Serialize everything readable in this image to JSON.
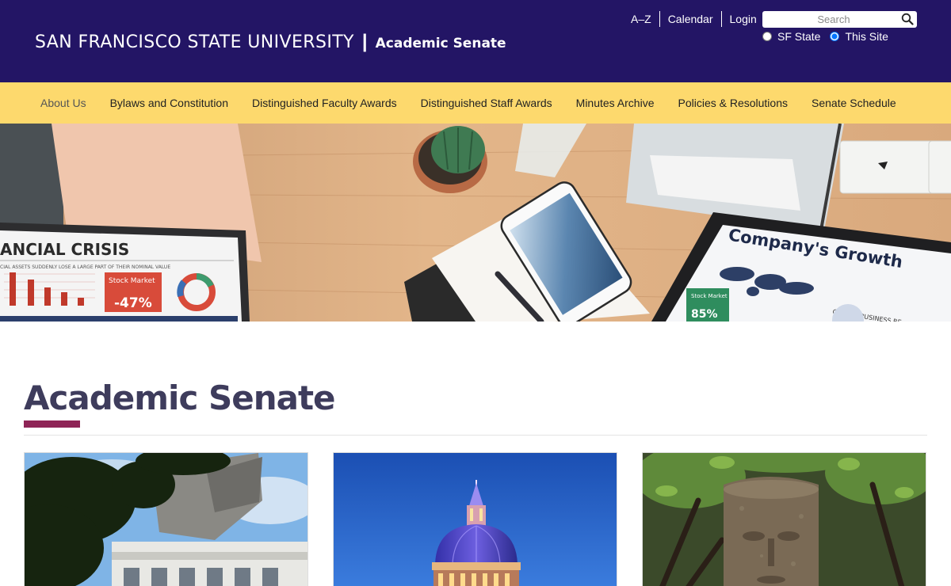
{
  "header": {
    "university": "SAN FRANCISCO STATE UNIVERSITY",
    "separator": "|",
    "site_name": "Academic Senate",
    "utility_links": [
      "A–Z",
      "Calendar",
      "Login"
    ],
    "search": {
      "placeholder": "Search",
      "scopes": [
        {
          "label": "SF State",
          "selected": false
        },
        {
          "label": "This Site",
          "selected": true
        }
      ]
    }
  },
  "nav": {
    "items": [
      "About Us",
      "Bylaws and Constitution",
      "Distinguished Faculty Awards",
      "Distinguished Staff Awards",
      "Minutes Archive",
      "Policies & Resolutions",
      "Senate Schedule"
    ]
  },
  "hero": {
    "laptop_text": {
      "headline": "ANCIAL CRISIS",
      "subline": "CIAL ASSETS SUDDENLY LOSE A LARGE PART OF THEIR NOMINAL VALUE",
      "stock_label": "Stock Market",
      "stock_value": "-47%"
    },
    "tablet_text": {
      "headline": "Company's Growth",
      "subline": "GLOBAL BUSINESS RE",
      "stock_label": "Stock Market",
      "stock_value": "85%"
    }
  },
  "main": {
    "title": "Academic Senate"
  },
  "colors": {
    "header_bg": "#231565",
    "nav_bg": "#fdd96d",
    "title_accent": "#8e2456",
    "title_text": "#3e3c5c"
  }
}
